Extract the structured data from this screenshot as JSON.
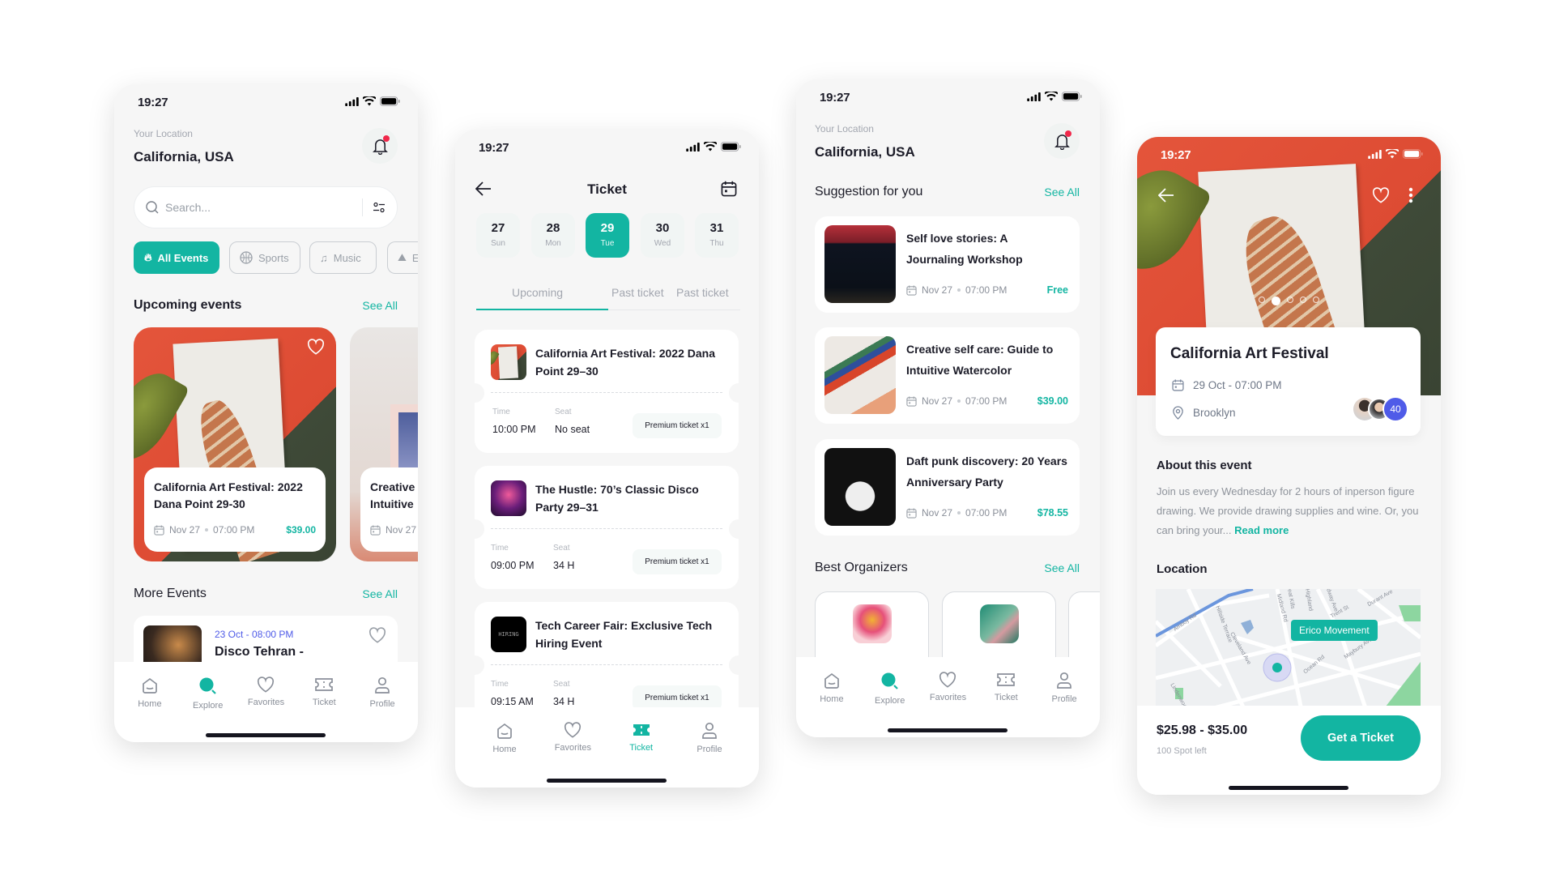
{
  "colors": {
    "accent": "#13B5A2",
    "date_blue": "#4F5BE8",
    "notification": "#F0284A",
    "avatar_count_bg": "#4F5BE8"
  },
  "status_time": "19:27",
  "tabbar": {
    "home": "Home",
    "explore": "Explore",
    "favorites": "Favorites",
    "ticket": "Ticket",
    "profile": "Profile"
  },
  "explore": {
    "location_label": "Your Location",
    "location_value": "California, USA",
    "search_placeholder": "Search...",
    "chips": [
      {
        "label": "All Events",
        "icon": "flame-icon"
      },
      {
        "label": "Sports",
        "icon": "ball-icon"
      },
      {
        "label": "Music",
        "icon": "music-icon"
      },
      {
        "label": "E",
        "icon": "art-icon"
      }
    ],
    "upcoming_title": "Upcoming events",
    "see_all": "See All",
    "upcoming": [
      {
        "title": "California Art Festival: 2022 Dana Point 29-30",
        "date": "Nov 27",
        "time": "07:00 PM",
        "price": "$39.00"
      },
      {
        "title": "Creative Intuitive",
        "date": "Nov 27"
      }
    ],
    "more_title": "More Events",
    "more": [
      {
        "datetime": "23 Oct - 08:00 PM",
        "title": "Disco Tehran -"
      }
    ]
  },
  "ticket": {
    "title": "Ticket",
    "dates": [
      {
        "n": "27",
        "d": "Sun"
      },
      {
        "n": "28",
        "d": "Mon"
      },
      {
        "n": "29",
        "d": "Tue"
      },
      {
        "n": "30",
        "d": "Wed"
      },
      {
        "n": "31",
        "d": "Thu"
      }
    ],
    "selected_date": "29",
    "tabs": [
      "Upcoming",
      "Past ticket",
      "Past ticket"
    ],
    "time_label": "Time",
    "seat_label": "Seat",
    "tickets": [
      {
        "title": "California Art Festival: 2022 Dana Point 29–30",
        "time": "10:00 PM",
        "seat": "No seat",
        "type": "Premium ticket x1"
      },
      {
        "title": "The Hustle: 70’s Classic Disco Party 29–31",
        "time": "09:00 PM",
        "seat": "34 H",
        "type": "Premium ticket x1"
      },
      {
        "title": "Tech Career Fair: Exclusive Tech Hiring Event",
        "time": "09:15 AM",
        "seat": "34 H",
        "type": "Premium ticket x1",
        "image_text": "HIRING"
      }
    ]
  },
  "suggest": {
    "location_label": "Your Location",
    "location_value": "California, USA",
    "title": "Suggestion for you",
    "see_all": "See All",
    "items": [
      {
        "title": "Self love stories: A Journaling Workshop",
        "date": "Nov 27",
        "time": "07:00 PM",
        "price": "Free"
      },
      {
        "title": "Creative self care: Guide to Intuitive Watercolor",
        "date": "Nov 27",
        "time": "07:00 PM",
        "price": "$39.00"
      },
      {
        "title": "Daft punk discovery: 20 Years Anniversary  Party",
        "date": "Nov 27",
        "time": "07:00 PM",
        "price": "$78.55"
      }
    ],
    "organizers_title": "Best Organizers",
    "organizers_see_all": "See All"
  },
  "detail": {
    "title": "California Art Festival",
    "datetime": "29 Oct - 07:00 PM",
    "place": "Brooklyn",
    "attendee_count": "40",
    "carousel": {
      "total": 5,
      "active": 2
    },
    "about_title": "About this event",
    "about_text": "Join us every Wednesday for 2 hours of inperson figure drawing. We provide drawing supplies and wine. Or, you can bring your...",
    "read_more": "Read more",
    "location_title": "Location",
    "map_label": "Erico Movement",
    "map_streets": [
      "Amboy Rd",
      "Hillside Terrace",
      "Cleveland Ave",
      "Midland Rd",
      "Great Kills",
      "Highland",
      "Fieldway Ave",
      "Trent St",
      "Durant Ave",
      "Maybury Ave",
      "Ocean Rd",
      "Lindenwood"
    ],
    "price_range": "$25.98 - $35.00",
    "spots_left": "100 Spot left",
    "cta": "Get a Ticket"
  }
}
